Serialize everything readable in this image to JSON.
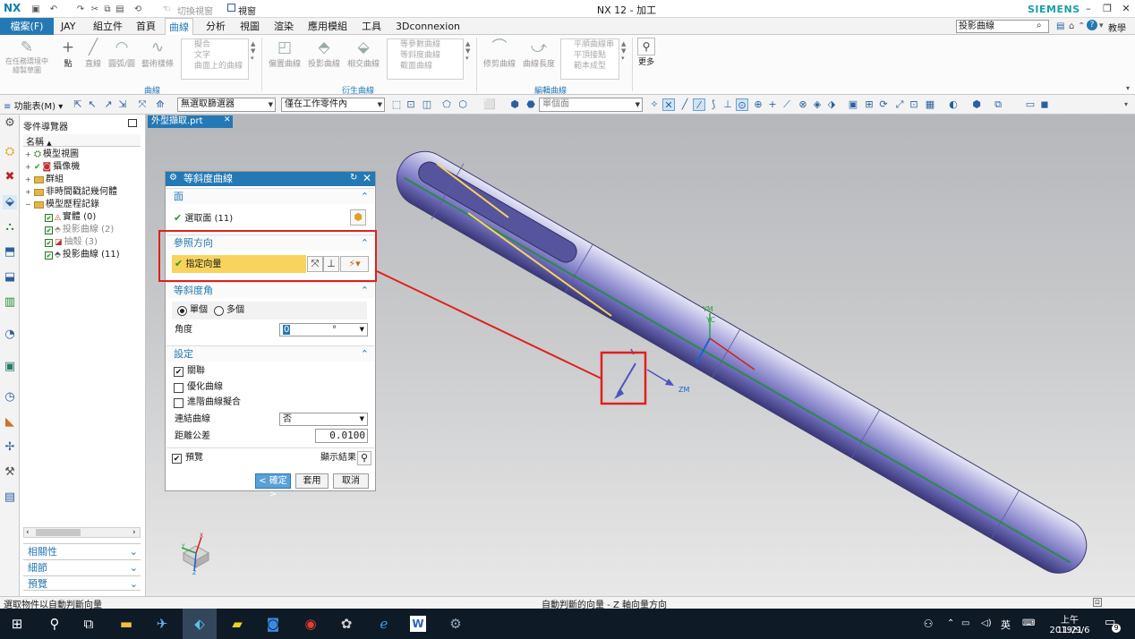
{
  "app": {
    "logo": "NX",
    "window_title": "NX 12 - 加工",
    "brand": "SIEMENS",
    "switch_window": "切換視窗",
    "window_menu": "視窗"
  },
  "menu": {
    "file": "檔案(F)",
    "tabs": [
      "JAY",
      "組立件",
      "首頁",
      "曲線",
      "分析",
      "視圖",
      "渲染",
      "應用模組",
      "工具",
      "3Dconnexion"
    ],
    "active_tab": "曲線",
    "search_value": "投影曲線",
    "teach": "教學"
  },
  "ribbon": {
    "buttons_left": [
      "在任務環境中繪製草圖",
      "點",
      "直線",
      "圓弧/圓",
      "藝術樣條"
    ],
    "list1": [
      "擬合",
      "文字",
      "曲面上的曲線"
    ],
    "derived": [
      "偏置曲線",
      "投影曲線",
      "相交曲線"
    ],
    "list2": [
      "等參數曲線",
      "等斜度曲線",
      "截面曲線"
    ],
    "edit_buttons": [
      "修剪曲線",
      "曲線長度"
    ],
    "list3": [
      "平順曲線串",
      "平頂接點",
      "範本成型"
    ],
    "more": "更多",
    "group_labels": [
      "曲線",
      "衍生曲線",
      "編輯曲線"
    ]
  },
  "toolbar": {
    "menu_label": "功能表(M)",
    "filter_select": "無選取篩選器",
    "scope_select": "僅在工作零件內",
    "face_select": "單個面"
  },
  "navigator": {
    "title": "零件導覽器",
    "column": "名稱",
    "items": [
      {
        "label": "模型視圖",
        "dim": false
      },
      {
        "label": "攝像機",
        "dim": false
      },
      {
        "label": "群組",
        "dim": false
      },
      {
        "label": "非時間戳記幾何體",
        "dim": false
      },
      {
        "label": "模型歷程記錄",
        "dim": false
      },
      {
        "label": "實體 (0)",
        "dim": false
      },
      {
        "label": "投影曲線 (2)",
        "dim": true
      },
      {
        "label": "抽殼 (3)",
        "dim": true
      },
      {
        "label": "投影曲線 (11)",
        "dim": false
      }
    ],
    "panels": [
      "相關性",
      "細節",
      "預覽"
    ]
  },
  "document": {
    "tab": "外型擷取.prt"
  },
  "dialog": {
    "title": "等斜度曲線",
    "face_section": "面",
    "select_face": "選取面 (11)",
    "ref_section": "參照方向",
    "specify_vector": "指定向量",
    "angle_section": "等斜度角",
    "single": "單個",
    "multiple": "多個",
    "angle_label": "角度",
    "angle_value": "0",
    "angle_unit": "°",
    "settings_section": "設定",
    "associative": "關聯",
    "optimize": "優化曲線",
    "advanced_fit": "進階曲線擬合",
    "join_label": "連結曲線",
    "join_value": "否",
    "tolerance_label": "距離公差",
    "tolerance_value": "0.0100",
    "preview": "預覽",
    "show_result": "顯示結果",
    "ok": "< 確定 >",
    "apply": "套用",
    "cancel": "取消"
  },
  "axes": {
    "ym": "YM",
    "yc": "YC",
    "zm": "ZM",
    "x": "X",
    "y": "Y",
    "z": "Z"
  },
  "status": {
    "left": "選取物件以自動判斷向量",
    "center": "自動判斷的向量 - Z 軸向量方向"
  },
  "taskbar": {
    "ime": "英",
    "time": "上午 11:21",
    "date": "2019/9/6",
    "notif_count": "9"
  },
  "colors": {
    "accent": "#2479b5",
    "highlight_yellow": "#f8d35e",
    "annotation_red": "#e0201c",
    "part_purple": "#7b78c4"
  }
}
